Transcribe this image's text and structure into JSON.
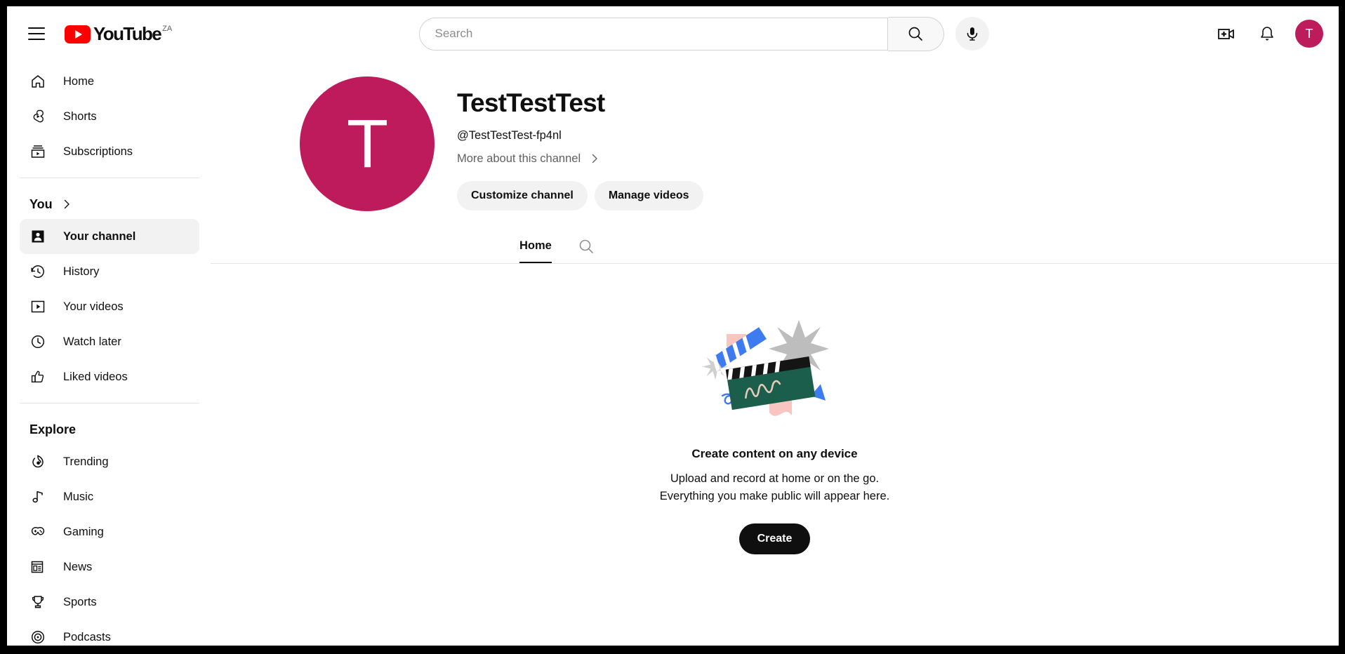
{
  "masthead": {
    "menu_icon": "hamburger-menu-icon",
    "logo_text": "YouTube",
    "logo_country_code": "ZA",
    "search": {
      "value": "",
      "placeholder": "Search",
      "search_icon": "search-icon",
      "mic_icon": "microphone-icon"
    },
    "create_icon": "create-video-icon",
    "notifications_icon": "bell-icon",
    "avatar_letter": "T",
    "avatar_color": "#bd1b5c"
  },
  "sidebar": {
    "primary": [
      {
        "label": "Home",
        "icon": "home-icon",
        "active": false
      },
      {
        "label": "Shorts",
        "icon": "shorts-icon",
        "active": false
      },
      {
        "label": "Subscriptions",
        "icon": "subscriptions-icon",
        "active": false
      }
    ],
    "you_header": "You",
    "you_items": [
      {
        "label": "Your channel",
        "icon": "person-icon",
        "active": true
      },
      {
        "label": "History",
        "icon": "history-icon",
        "active": false
      },
      {
        "label": "Your videos",
        "icon": "your-videos-icon",
        "active": false
      },
      {
        "label": "Watch later",
        "icon": "clock-icon",
        "active": false
      },
      {
        "label": "Liked videos",
        "icon": "thumbs-up-icon",
        "active": false
      }
    ],
    "explore_header": "Explore",
    "explore_items": [
      {
        "label": "Trending",
        "icon": "trending-icon"
      },
      {
        "label": "Music",
        "icon": "music-note-icon"
      },
      {
        "label": "Gaming",
        "icon": "gamepad-icon"
      },
      {
        "label": "News",
        "icon": "newspaper-icon"
      },
      {
        "label": "Sports",
        "icon": "trophy-icon"
      },
      {
        "label": "Podcasts",
        "icon": "podcast-icon"
      }
    ]
  },
  "channel": {
    "avatar_letter": "T",
    "avatar_color": "#bd1b5c",
    "name": "TestTestTest",
    "handle": "@TestTestTest-fp4nl",
    "more_about_label": "More about this channel",
    "customize_label": "Customize channel",
    "manage_videos_label": "Manage videos",
    "tabs": [
      {
        "label": "Home",
        "active": true
      }
    ],
    "tab_search_icon": "search-icon"
  },
  "empty_state": {
    "illustration": "clapperboard-illustration",
    "title": "Create content on any device",
    "line1": "Upload and record at home or on the go.",
    "line2": "Everything you make public will appear here.",
    "create_label": "Create"
  }
}
